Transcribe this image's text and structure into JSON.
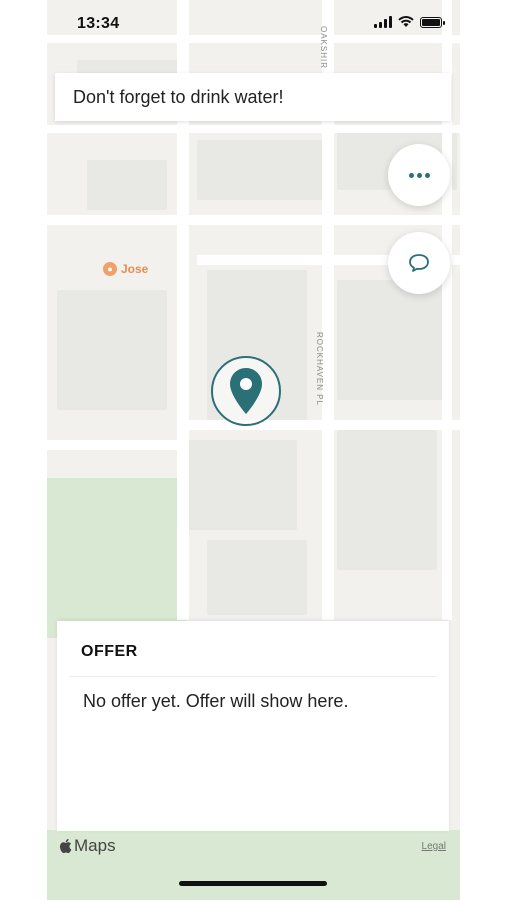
{
  "status_bar": {
    "time": "13:34"
  },
  "banner": {
    "text": "Don't forget to drink water!"
  },
  "map": {
    "poi_label": "Jose",
    "street_oakshire": "OAKSHIR",
    "street_rockhaven": "ROCKHAVEN PL",
    "maps_brand": "Maps",
    "legal_link": "Legal"
  },
  "actions": {
    "more_icon": "more-icon",
    "chat_icon": "chat-bubble-icon"
  },
  "offer": {
    "title": "OFFER",
    "message": "No offer yet. Offer will show here."
  },
  "colors": {
    "accent": "#2b6f77",
    "poi": "#e88d4f"
  }
}
